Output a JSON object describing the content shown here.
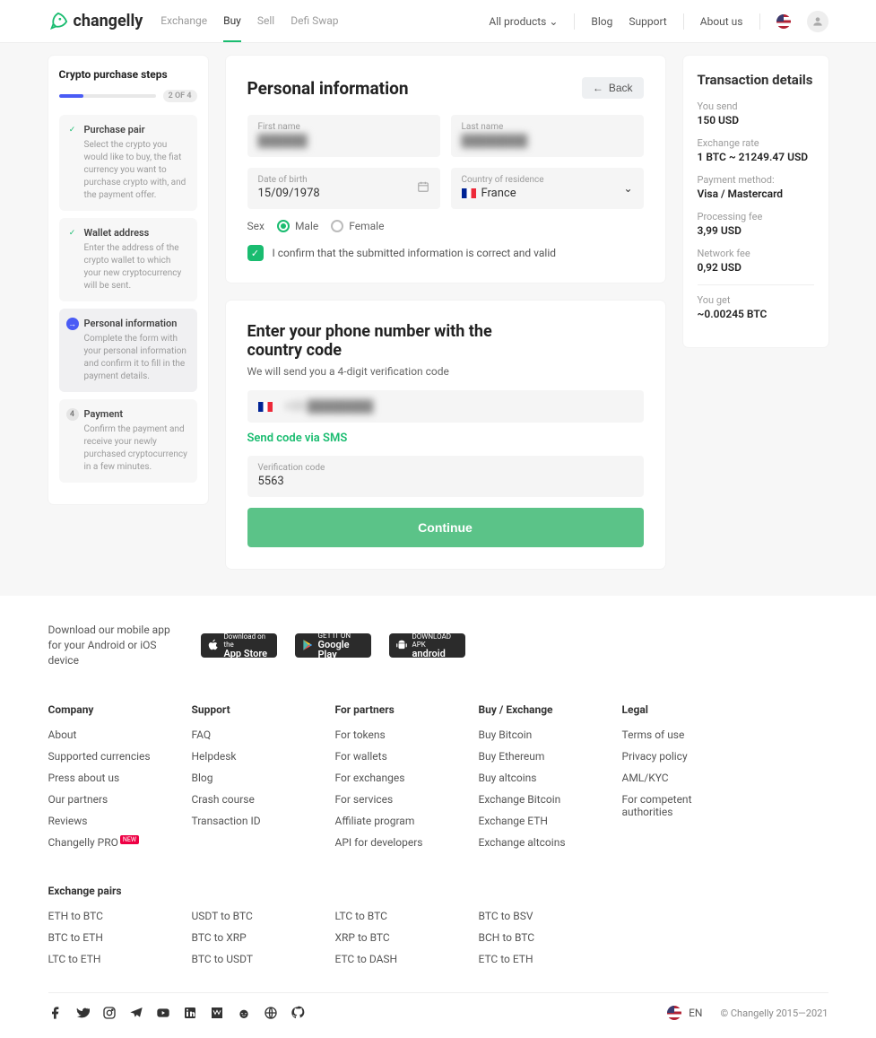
{
  "header": {
    "brand": "changelly",
    "nav": [
      "Exchange",
      "Buy",
      "Sell",
      "Defi Swap"
    ],
    "activeNav": 1,
    "allProducts": "All products",
    "links": [
      "Blog",
      "Support",
      "About us"
    ]
  },
  "steps": {
    "title": "Crypto purchase steps",
    "progress": "2 OF 4",
    "items": [
      {
        "title": "Purchase pair",
        "desc": "Select the crypto you would like to buy, the fiat currency you want to purchase crypto with, and the payment offer.",
        "state": "done"
      },
      {
        "title": "Wallet address",
        "desc": "Enter the address of the crypto wallet to which your new cryptocurrency will be sent.",
        "state": "done"
      },
      {
        "title": "Personal information",
        "desc": "Complete the form with your personal information and confirm it to fill in the payment details.",
        "state": "current"
      },
      {
        "title": "Payment",
        "desc": "Confirm the payment and receive your newly purchased cryptocurrency in a few minutes.",
        "state": "pending",
        "num": "4"
      }
    ]
  },
  "personal": {
    "heading": "Personal information",
    "back": "Back",
    "firstName": {
      "label": "First name",
      "value": "██████"
    },
    "lastName": {
      "label": "Last name",
      "value": "████████"
    },
    "dob": {
      "label": "Date of birth",
      "value": "15/09/1978"
    },
    "country": {
      "label": "Country of residence",
      "value": "France"
    },
    "sexLabel": "Sex",
    "male": "Male",
    "female": "Female",
    "confirm": "I confirm that the submitted information is correct and valid"
  },
  "phone": {
    "heading": "Enter your phone number with the country code",
    "sub": "We will send you a 4-digit verification code",
    "number": "+33 ████████",
    "sendLink": "Send code via SMS",
    "codeLabel": "Verification code",
    "codeValue": "5563",
    "continue": "Continue"
  },
  "details": {
    "heading": "Transaction details",
    "sendLabel": "You send",
    "sendValue": "150 USD",
    "rateLabel": "Exchange rate",
    "rateValue": "1 BTC ~ 21249.47 USD",
    "methodLabel": "Payment method:",
    "methodValue": "Visa / Mastercard",
    "procLabel": "Processing fee",
    "procValue": "3,99 USD",
    "netLabel": "Network fee",
    "netValue": "0,92 USD",
    "getLabel": "You get",
    "getValue": "~0.00245 BTC"
  },
  "footer": {
    "dlText": "Download our mobile app for your Android or iOS device",
    "stores": {
      "apple": {
        "small": "Download on the",
        "big": "App Store"
      },
      "google": {
        "small": "GET IT ON",
        "big": "Google Play"
      },
      "android": {
        "small": "DOWNLOAD APK",
        "big": "android"
      }
    },
    "cols": {
      "company": {
        "title": "Company",
        "links": [
          "About",
          "Supported currencies",
          "Press about us",
          "Our partners",
          "Reviews",
          "Changelly PRO"
        ]
      },
      "support": {
        "title": "Support",
        "links": [
          "FAQ",
          "Helpdesk",
          "Blog",
          "Crash course",
          "Transaction ID"
        ]
      },
      "partners": {
        "title": "For partners",
        "links": [
          "For tokens",
          "For wallets",
          "For exchanges",
          "For services",
          "Affiliate program",
          "API for developers"
        ]
      },
      "buyex": {
        "title": "Buy / Exchange",
        "links": [
          "Buy Bitcoin",
          "Buy Ethereum",
          "Buy altcoins",
          "Exchange Bitcoin",
          "Exchange ETH",
          "Exchange altcoins"
        ]
      },
      "legal": {
        "title": "Legal",
        "links": [
          "Terms of use",
          "Privacy policy",
          "AML/KYC",
          "For competent authorities"
        ]
      }
    },
    "pairs": {
      "title": "Exchange pairs",
      "cols": [
        [
          "ETH to BTC",
          "BTC to ETH",
          "LTC to ETH"
        ],
        [
          "USDT to BTC",
          "BTC to XRP",
          "BTC to USDT"
        ],
        [
          "LTC to BTC",
          "XRP to BTC",
          "ETC to DASH"
        ],
        [
          "BTC to BSV",
          "BCH to BTC",
          "ETC to ETH"
        ]
      ]
    },
    "lang": "EN",
    "copyright": "© Changelly 2015—2021"
  }
}
